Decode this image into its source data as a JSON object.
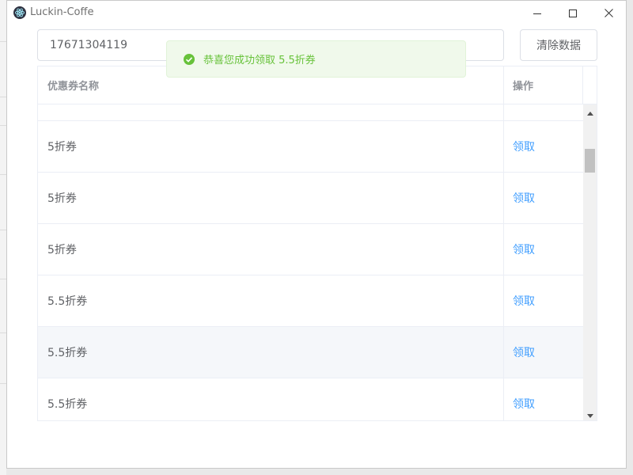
{
  "window": {
    "title": "Luckin-Coffe"
  },
  "form": {
    "phone_value": "17671304119",
    "clear_label": "清除数据"
  },
  "table": {
    "columns": [
      "优惠券名称",
      "操作"
    ],
    "rows": [
      {
        "name": "",
        "action": ""
      },
      {
        "name": "5折券",
        "action": "领取"
      },
      {
        "name": "5折券",
        "action": "领取"
      },
      {
        "name": "5折券",
        "action": "领取"
      },
      {
        "name": "5.5折券",
        "action": "领取"
      },
      {
        "name": "5.5折券",
        "action": "领取"
      },
      {
        "name": "5.5折券",
        "action": "领取"
      }
    ]
  },
  "toast": {
    "message": "恭喜您成功领取 5.5折券",
    "type": "success"
  },
  "colors": {
    "accent": "#409eff",
    "success": "#67c23a",
    "hover_row": "#f5f7fa"
  },
  "icons": [
    "app-logo-icon",
    "minimize-icon",
    "maximize-icon",
    "close-icon",
    "success-check-icon",
    "scroll-up-icon",
    "scroll-down-icon"
  ]
}
